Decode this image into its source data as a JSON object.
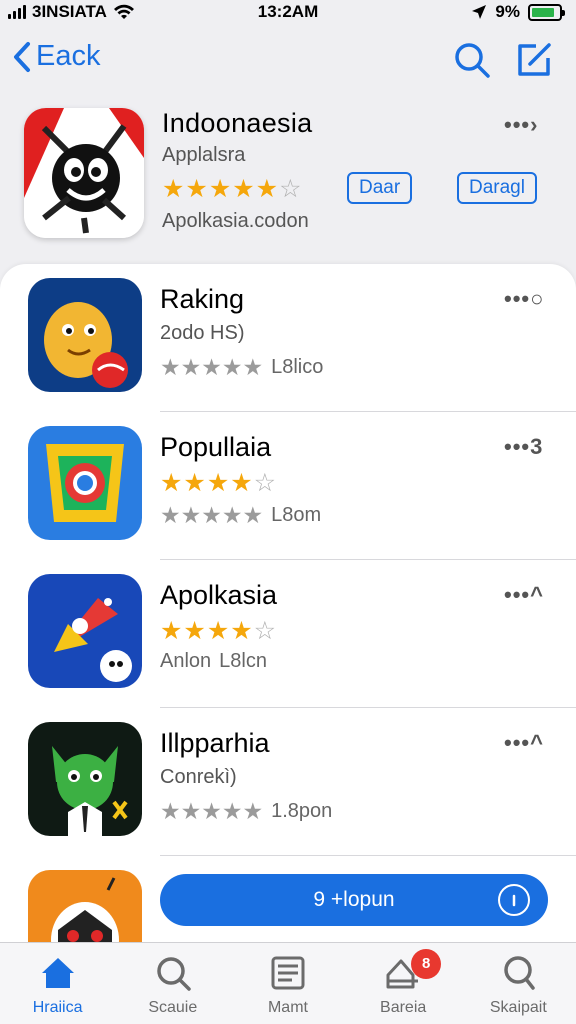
{
  "status": {
    "carrier": "3INSIATA",
    "time": "13:2AM",
    "battery_pct": "9%",
    "battery_level": 0.85
  },
  "nav": {
    "back_label": "Eack"
  },
  "featured": {
    "title": "Indoonaesia",
    "subtitle": "Applalsra",
    "stars": "★★★★★",
    "star_empty": "☆",
    "developer": "Apolkasia.codon",
    "button1": "Daar",
    "button2": "Daragl",
    "more": "•••›"
  },
  "list": [
    {
      "title": "Raking",
      "subtitle": "2odo HS)",
      "rating_text": "L8lico",
      "more": "•••○"
    },
    {
      "title": "Popullaia",
      "gold_stars": "★★★★",
      "rating_text": "L8om",
      "more": "•••3"
    },
    {
      "title": "Apolkasia",
      "gold_stars": "★★★★",
      "rating_prefix": "Anlon",
      "rating_text": "L8lcn",
      "more": "•••^"
    },
    {
      "title": "Illpparhia",
      "subtitle": "Conrekì)",
      "rating_text": "1.8pon",
      "more": "•••^"
    }
  ],
  "gray_stars": "★★★★★",
  "cta": {
    "label": "9 +lopun"
  },
  "tabs": [
    {
      "label": "Hraiica",
      "icon": "home-icon"
    },
    {
      "label": "Scauie",
      "icon": "search-icon"
    },
    {
      "label": "Mamt",
      "icon": "news-icon"
    },
    {
      "label": "Bareia",
      "icon": "updates-icon",
      "badge": "8"
    },
    {
      "label": "Skaipait",
      "icon": "account-icon"
    }
  ],
  "colors": {
    "accent": "#1a6fe0",
    "star": "#f5a70c",
    "badge": "#e8382f"
  }
}
